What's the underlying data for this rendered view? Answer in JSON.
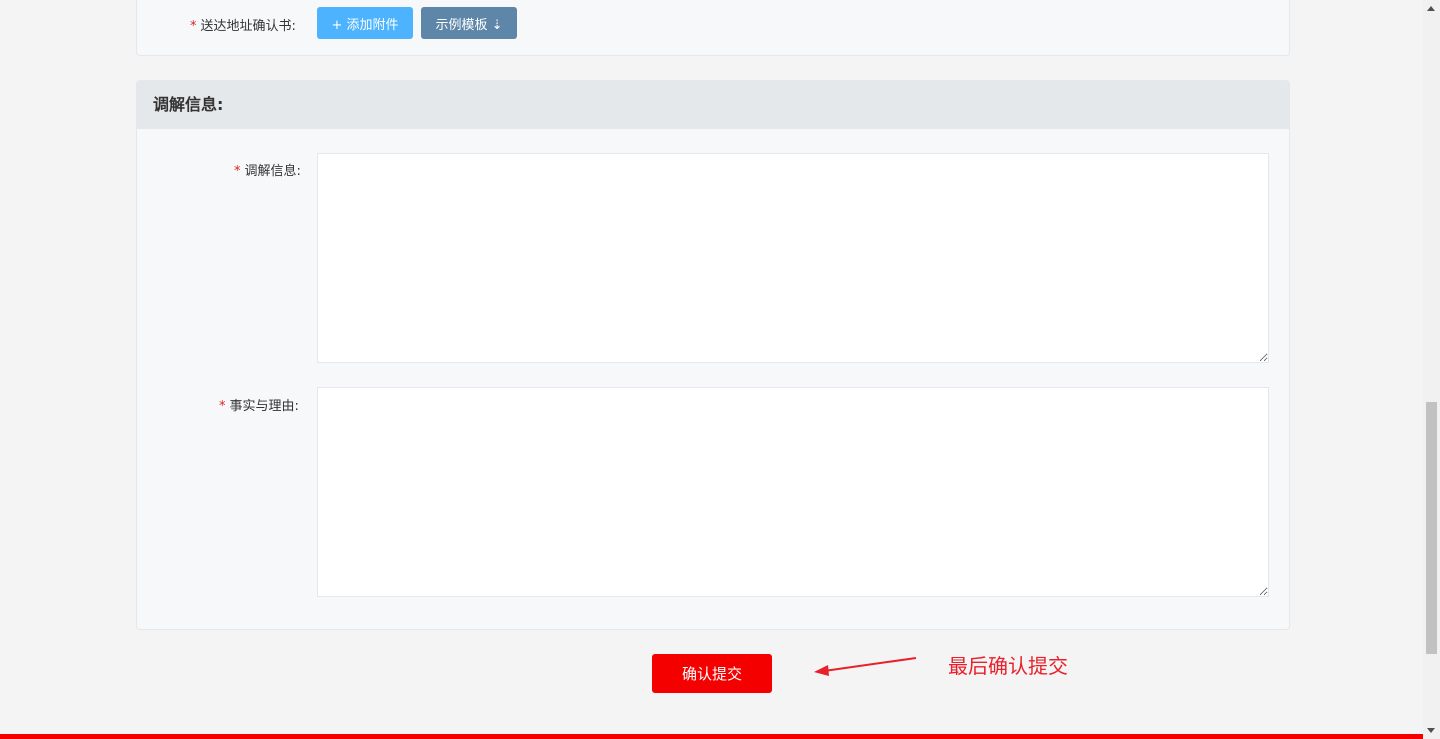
{
  "attachment_row": {
    "required_mark": "*",
    "label": "送达地址确认书:",
    "upload_button": "+ 添加附件",
    "template_button": "示例模板 ⇣"
  },
  "mediation_section": {
    "header": "调解信息:",
    "fields": [
      {
        "required_mark": "*",
        "label": "调解信息:",
        "value": ""
      },
      {
        "required_mark": "*",
        "label": "事实与理由:",
        "value": ""
      }
    ]
  },
  "submit": {
    "label": "确认提交"
  },
  "annotation": {
    "text": "最后确认提交",
    "color": "#e8202a"
  },
  "colors": {
    "primary_red": "#f40000",
    "upload_blue": "#4db3ff",
    "template_blue": "#5d86a8"
  }
}
